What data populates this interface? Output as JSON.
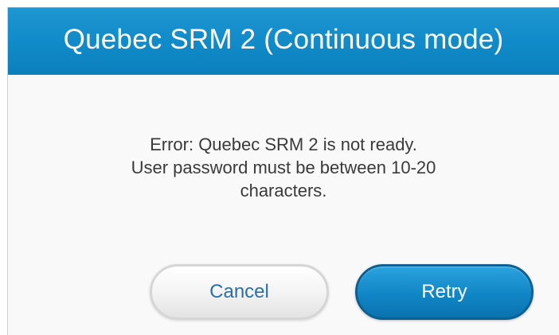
{
  "dialog": {
    "title": "Quebec SRM 2 (Continuous mode)",
    "message_lines": [
      "Error: Quebec SRM 2 is not ready.",
      "User password must be between 10-20",
      "characters."
    ],
    "buttons": {
      "cancel_label": "Cancel",
      "retry_label": "Retry"
    }
  },
  "colors": {
    "titlebar": "#108ac8",
    "primary_button": "#1186c6",
    "cancel_text": "#2d6fa0",
    "message_text": "#3a3a3a"
  }
}
